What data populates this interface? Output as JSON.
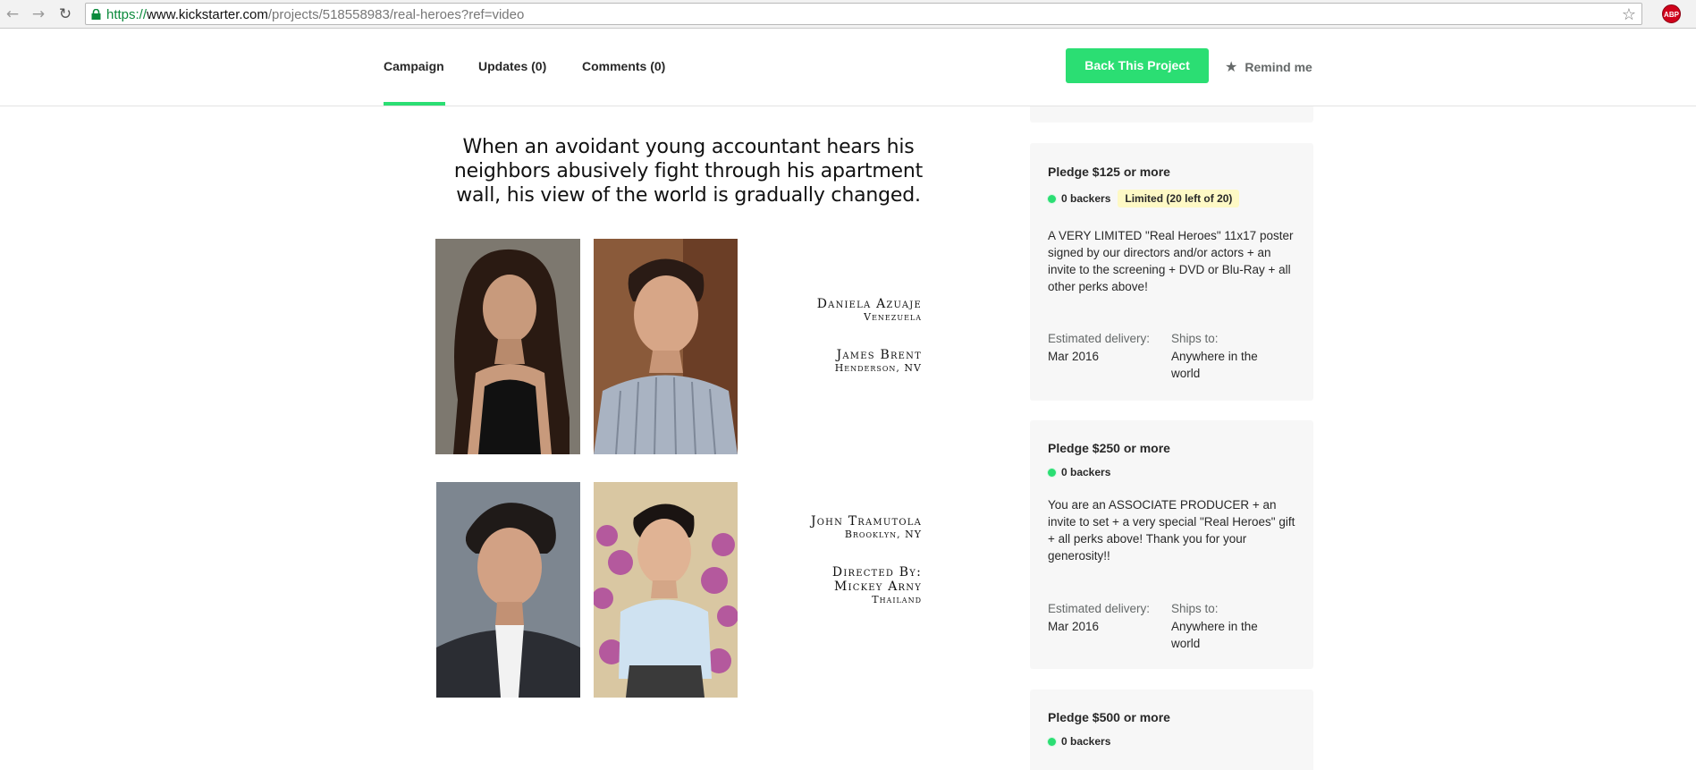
{
  "browser": {
    "url_scheme": "https://",
    "url_host": "www.kickstarter.com",
    "url_path": "/projects/518558983/real-heroes?ref=video",
    "abp_label": "ABP",
    "back_icon": "back-arrow-icon",
    "forward_icon": "forward-arrow-icon",
    "reload_icon": "reload-icon"
  },
  "nav": {
    "tabs": [
      {
        "label": "Campaign",
        "active": true
      },
      {
        "label": "Updates (0)",
        "active": false
      },
      {
        "label": "Comments (0)",
        "active": false
      }
    ],
    "back_button": "Back This Project",
    "remind": "Remind me"
  },
  "campaign": {
    "tagline": "When an avoidant young accountant hears his neighbors abusively fight through his apartment wall, his view of the world is gradually changed.",
    "cast_top": [
      {
        "name": "Daniela Azuaje",
        "location": "Venezuela"
      },
      {
        "name": "James Brent",
        "location": "Henderson, NV"
      }
    ],
    "cast_bottom": [
      {
        "name": "John Tramutola",
        "location": "Brooklyn, NY"
      },
      {
        "name": "Directed By:",
        "name2": "Mickey Arny",
        "location": "Thailand"
      }
    ]
  },
  "rewards": [
    {
      "title": "Pledge $125 or more",
      "backers": "0 backers",
      "limited": "Limited (20 left of 20)",
      "description": "A VERY LIMITED \"Real Heroes\" 11x17 poster signed by our directors and/or actors + an invite to the screening + DVD or Blu-Ray + all other perks above!",
      "delivery_label": "Estimated delivery:",
      "delivery_value": "Mar 2016",
      "ships_label": "Ships to:",
      "ships_value": "Anywhere in the world"
    },
    {
      "title": "Pledge $250 or more",
      "backers": "0 backers",
      "description": "You are an ASSOCIATE PRODUCER + an invite to set + a very special \"Real Heroes\" gift + all perks above! Thank you for your generosity!!",
      "delivery_label": "Estimated delivery:",
      "delivery_value": "Mar 2016",
      "ships_label": "Ships to:",
      "ships_value": "Anywhere in the world"
    },
    {
      "title": "Pledge $500 or more",
      "backers": "0 backers"
    }
  ],
  "colors": {
    "accent": "#2bde73",
    "card_bg": "#f7f7f7",
    "limited_bg": "#fef9c5"
  }
}
